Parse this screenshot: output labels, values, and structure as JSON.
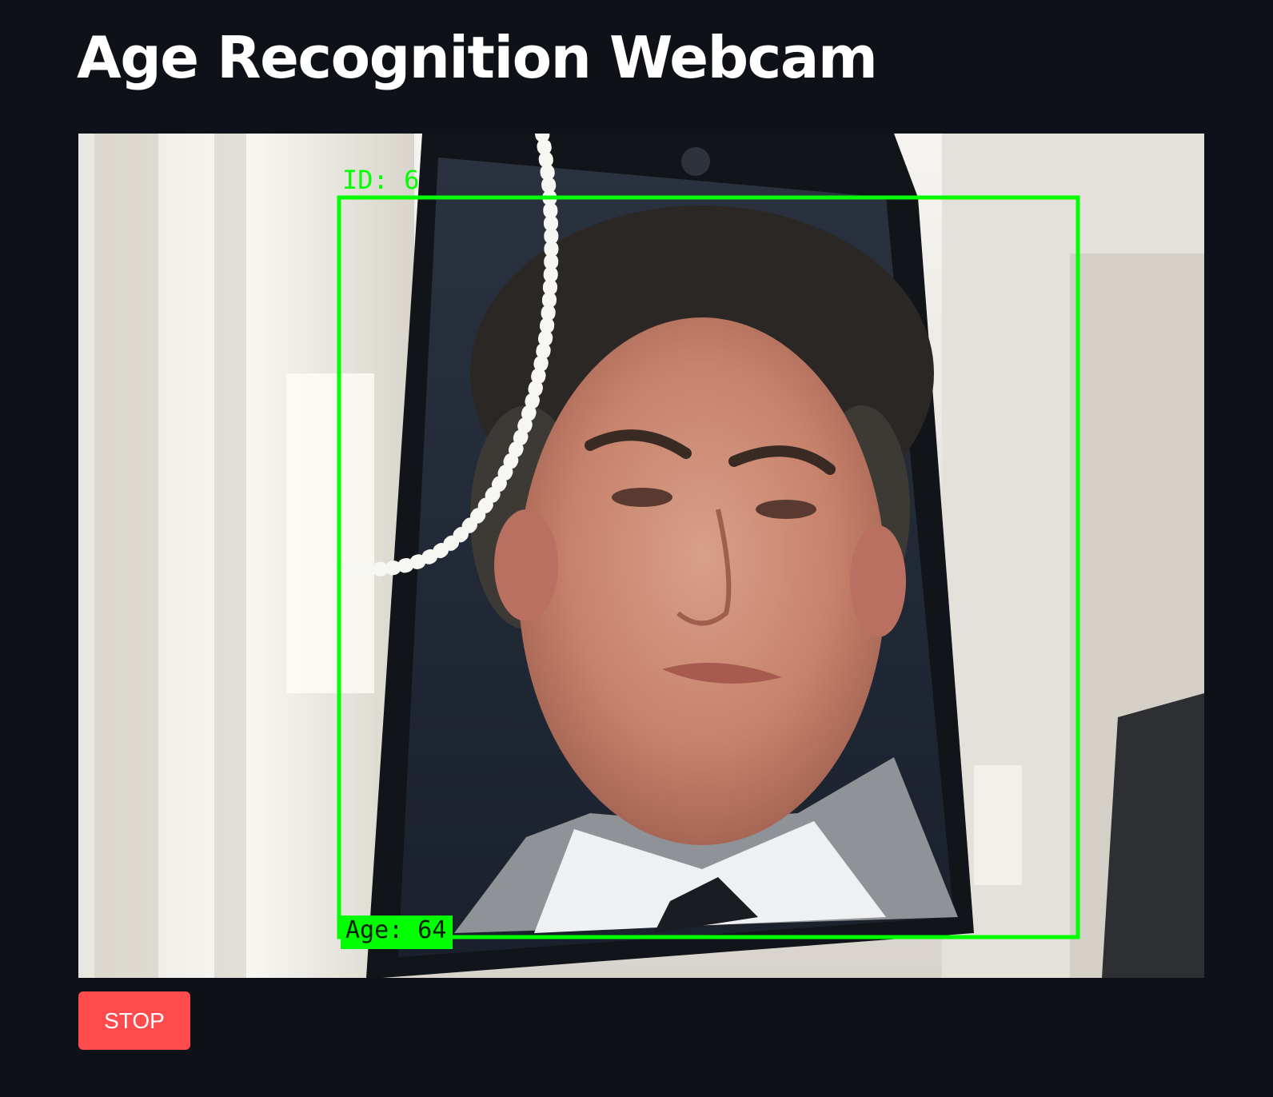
{
  "page": {
    "title": "Age Recognition Webcam"
  },
  "video_feed": {
    "overlay": {
      "id_text": "ID: 6",
      "age_text": "Age: 64",
      "box_color": "#00ff00"
    }
  },
  "controls": {
    "stop_label": "STOP",
    "stop_color": "#ff4b4b"
  },
  "theme": {
    "background": "#0e1117",
    "text": "#ffffff"
  }
}
